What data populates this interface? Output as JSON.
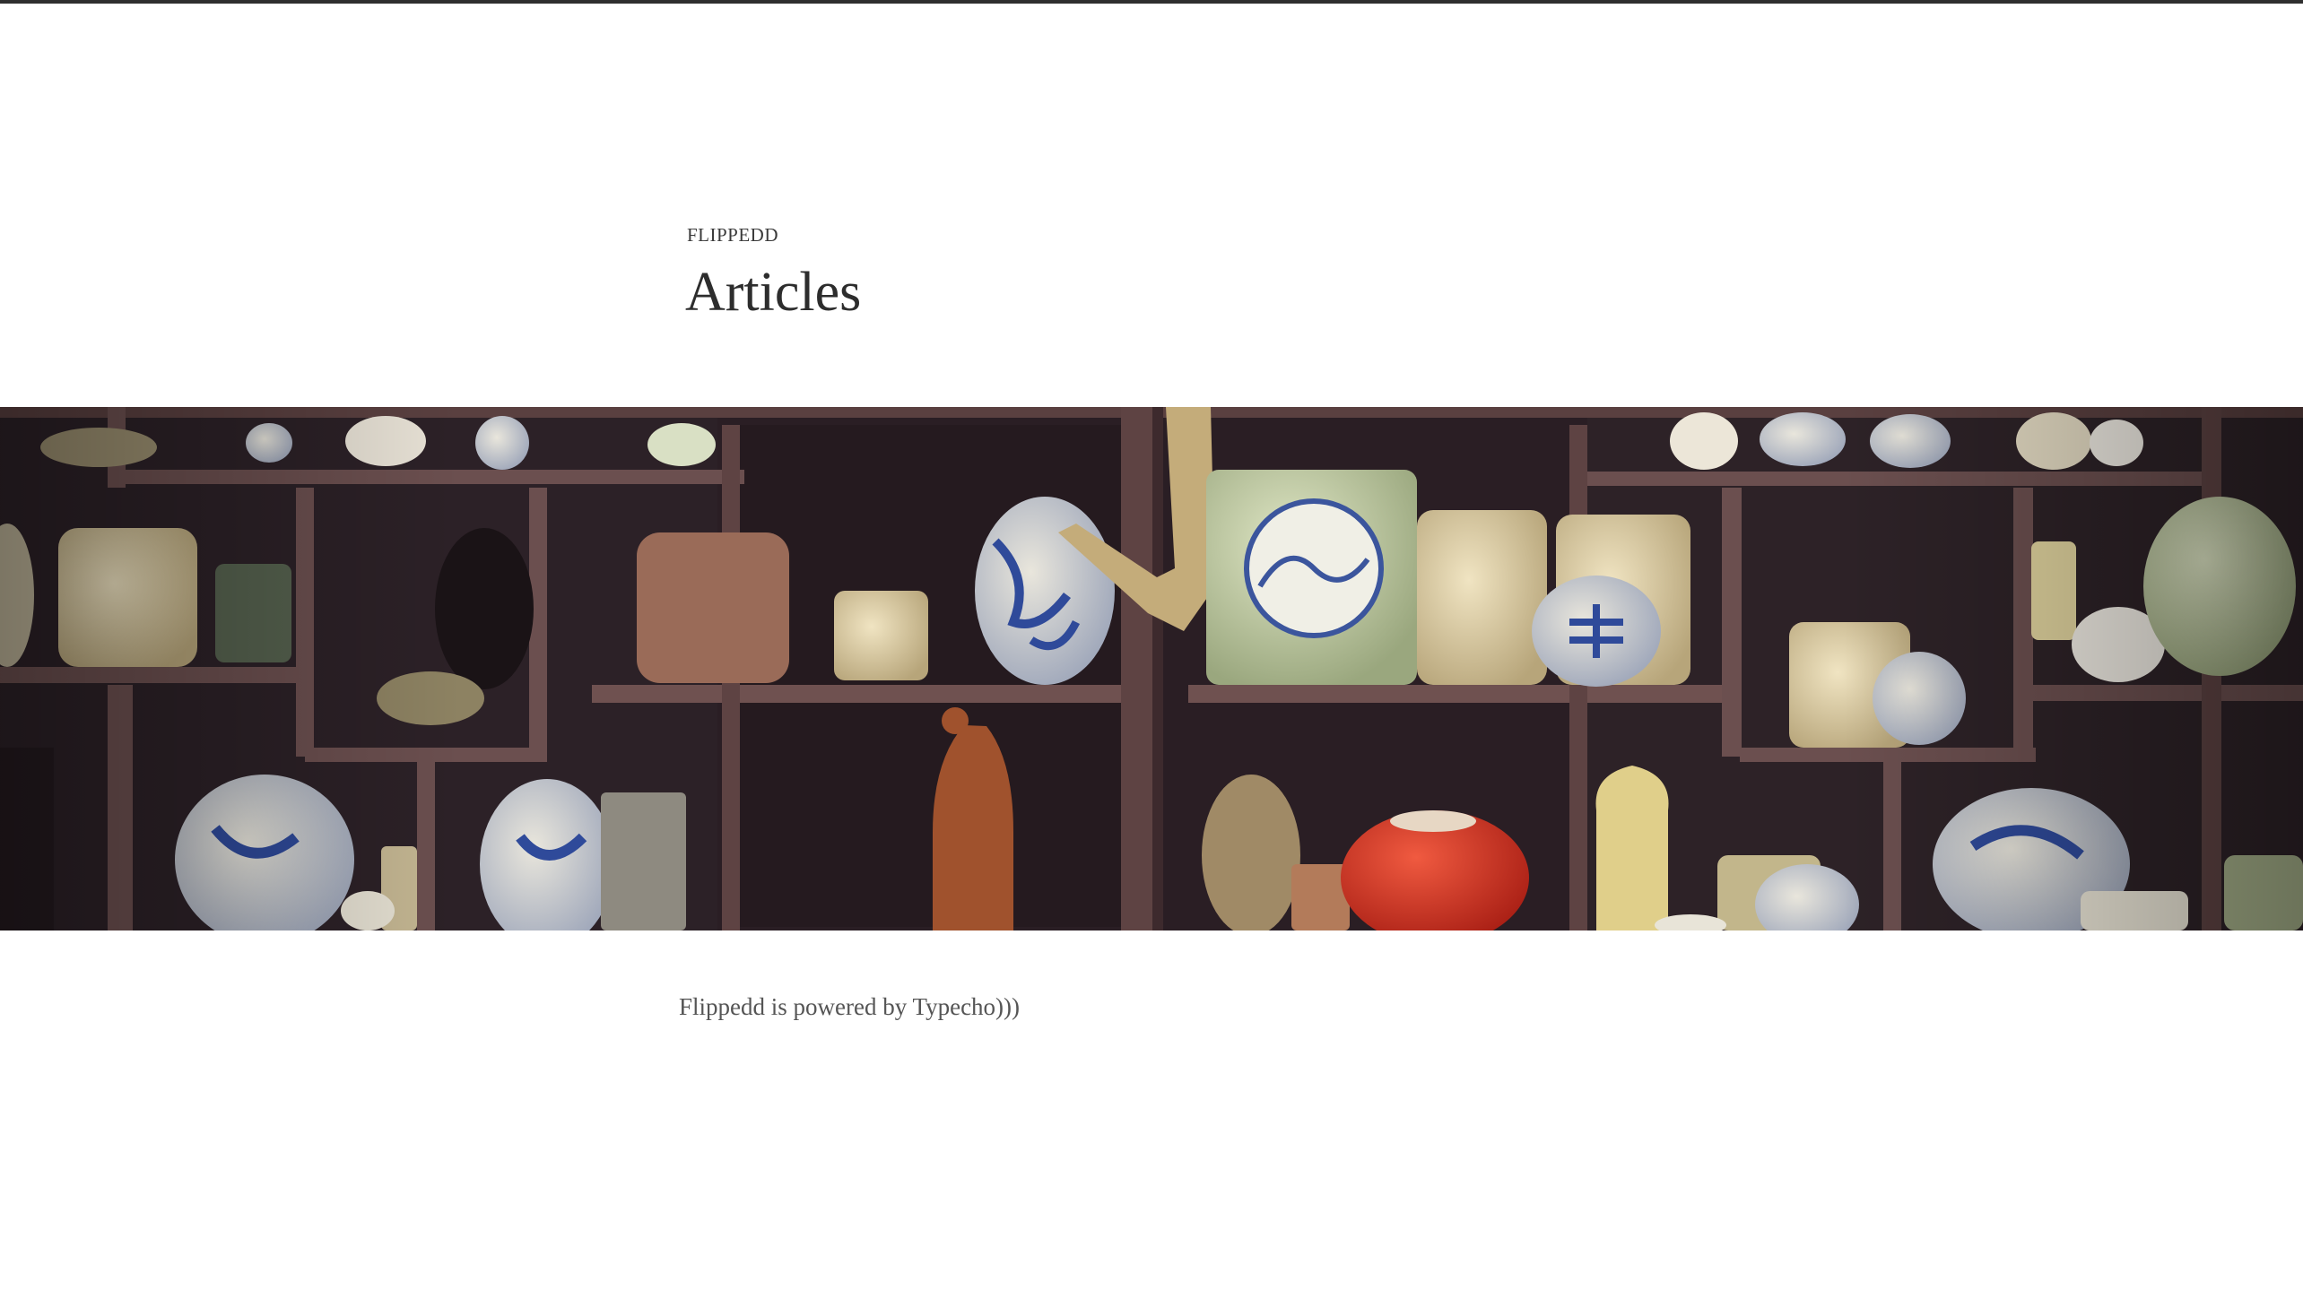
{
  "header": {
    "site_name": "FLIPPEDD",
    "title": "Articles"
  },
  "hero": {
    "image_name": "cabinet-of-ceramics-photo"
  },
  "footer": {
    "text": "Flippedd is powered by Typecho)))"
  },
  "colors": {
    "top_border": "#2f2f2f",
    "text": "#333333",
    "footer_text": "#555555",
    "background": "#ffffff"
  }
}
